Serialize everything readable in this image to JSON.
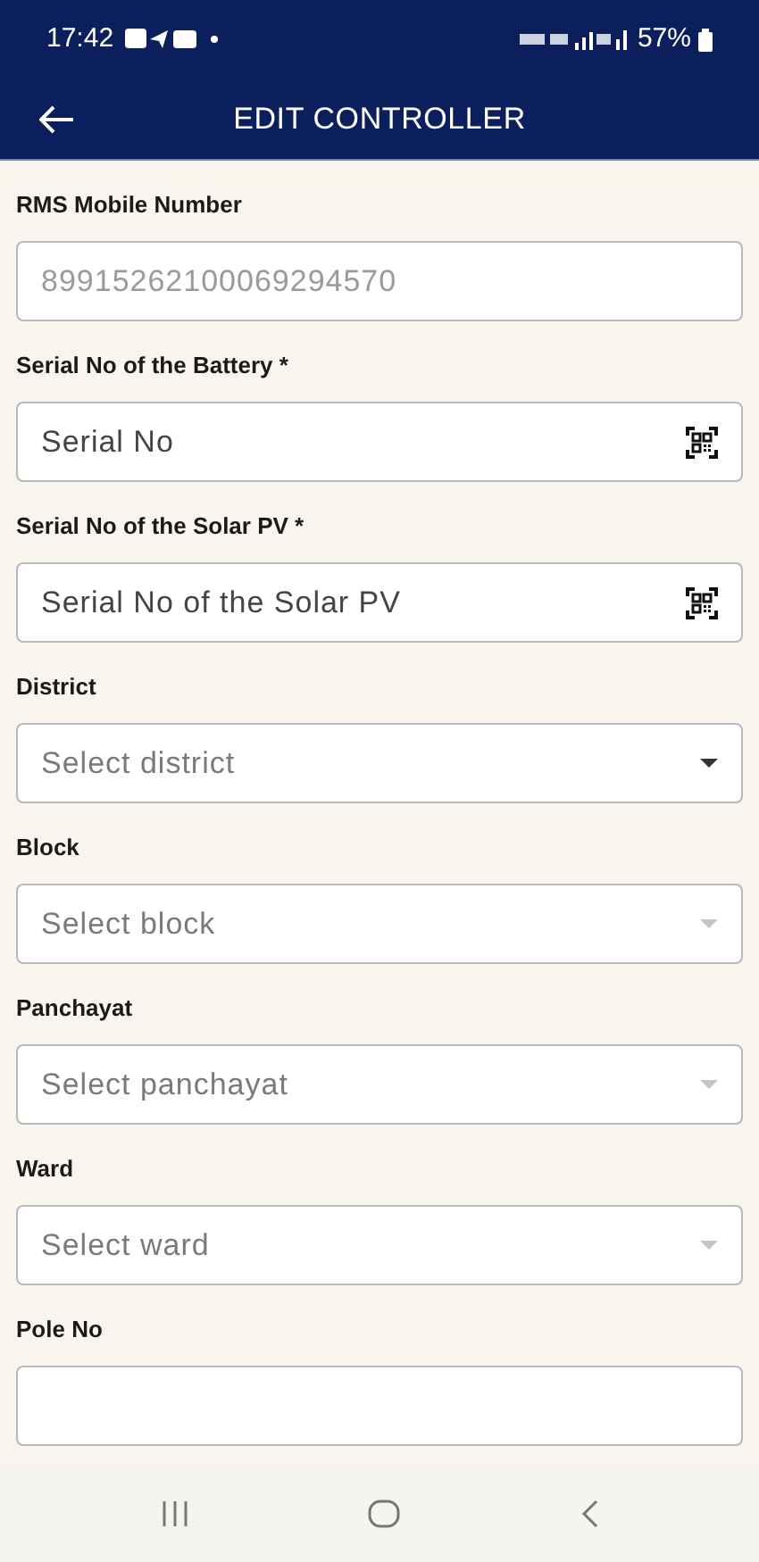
{
  "status_bar": {
    "time": "17:42",
    "battery": "57%"
  },
  "header": {
    "title": "EDIT CONTROLLER"
  },
  "fields": [
    {
      "label": "RMS Mobile Number",
      "kind": "text",
      "value": "89915262100069294570",
      "disabled": true
    },
    {
      "label": "Serial No of the Battery *",
      "kind": "scan",
      "placeholder": "Serial No"
    },
    {
      "label": "Serial No of the Solar PV *",
      "kind": "scan",
      "placeholder": "Serial No of the Solar PV"
    },
    {
      "label": "District",
      "kind": "select",
      "placeholder": "Select district",
      "disabled": false
    },
    {
      "label": "Block",
      "kind": "select",
      "placeholder": "Select block",
      "disabled": true
    },
    {
      "label": "Panchayat",
      "kind": "select",
      "placeholder": "Select panchayat",
      "disabled": true
    },
    {
      "label": "Ward",
      "kind": "select",
      "placeholder": "Select ward",
      "disabled": true
    },
    {
      "label": "Pole No",
      "kind": "text"
    }
  ]
}
